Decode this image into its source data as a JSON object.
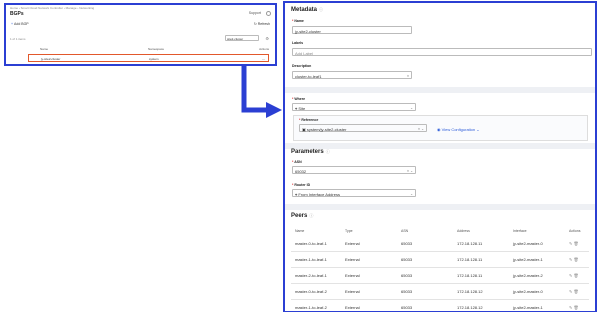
{
  "left_window": {
    "breadcrumb": "Home › Smart Cloud Network Controller › Manage › Networking",
    "page_title": "BGPs",
    "support_label": "Support",
    "add_button_label": "Add BGP",
    "refresh_label": "Refresh",
    "item_count": "1 of 1 items",
    "search_value": "site2-cluster",
    "table": {
      "columns": [
        "Name",
        "Namespace",
        "Actions"
      ],
      "rows": [
        {
          "name": "jy-site2-cluster",
          "namespace": "system",
          "actions": "⋯"
        }
      ]
    }
  },
  "right_window": {
    "metadata": {
      "title": "Metadata",
      "name_label": "Name",
      "name_value": "jy-site2-cluster",
      "labels_label": "Labels",
      "labels_placeholder": "Add Label",
      "description_label": "Description",
      "description_value": "cluster-to-leaf1"
    },
    "where": {
      "label": "Where",
      "value": "Site",
      "reference_label": "Reference",
      "reference_value": "system/jy-site2-cluster",
      "view_configuration": "View Configuration"
    },
    "parameters": {
      "title": "Parameters",
      "asn_label": "ASN",
      "asn_value": "65032",
      "router_id_label": "Router ID",
      "router_id_value": "From Interface Address"
    },
    "peers": {
      "title": "Peers",
      "columns": [
        "Name",
        "Type",
        "ASN",
        "Address",
        "Interface",
        "Actions"
      ],
      "rows": [
        {
          "name": "master-0-to-leaf-1",
          "type": "External",
          "asn": "65033",
          "address": "172.18.128.11",
          "interface": "jy-site2-master-0"
        },
        {
          "name": "master-1-to-leaf-1",
          "type": "External",
          "asn": "65033",
          "address": "172.18.128.11",
          "interface": "jy-site2-master-1"
        },
        {
          "name": "master-2-to-leaf-1",
          "type": "External",
          "asn": "65033",
          "address": "172.18.128.11",
          "interface": "jy-site2-master-2"
        },
        {
          "name": "master-0-to-leaf-2",
          "type": "External",
          "asn": "65033",
          "address": "172.18.128.12",
          "interface": "jy-site2-master-0"
        },
        {
          "name": "master-1-to-leaf-2",
          "type": "External",
          "asn": "65033",
          "address": "172.18.128.12",
          "interface": "jy-site2-master-1"
        }
      ]
    }
  },
  "colors": {
    "frame": "#2b3fd3",
    "highlight": "#e2582c",
    "link": "#2b5bd9"
  },
  "icons": [
    "info-icon",
    "help-icon",
    "plus-icon",
    "refresh-icon",
    "filter-icon",
    "location-icon",
    "copy-icon",
    "close-icon",
    "chevron-down-icon",
    "edit-icon",
    "delete-icon",
    "arrow-icon"
  ]
}
